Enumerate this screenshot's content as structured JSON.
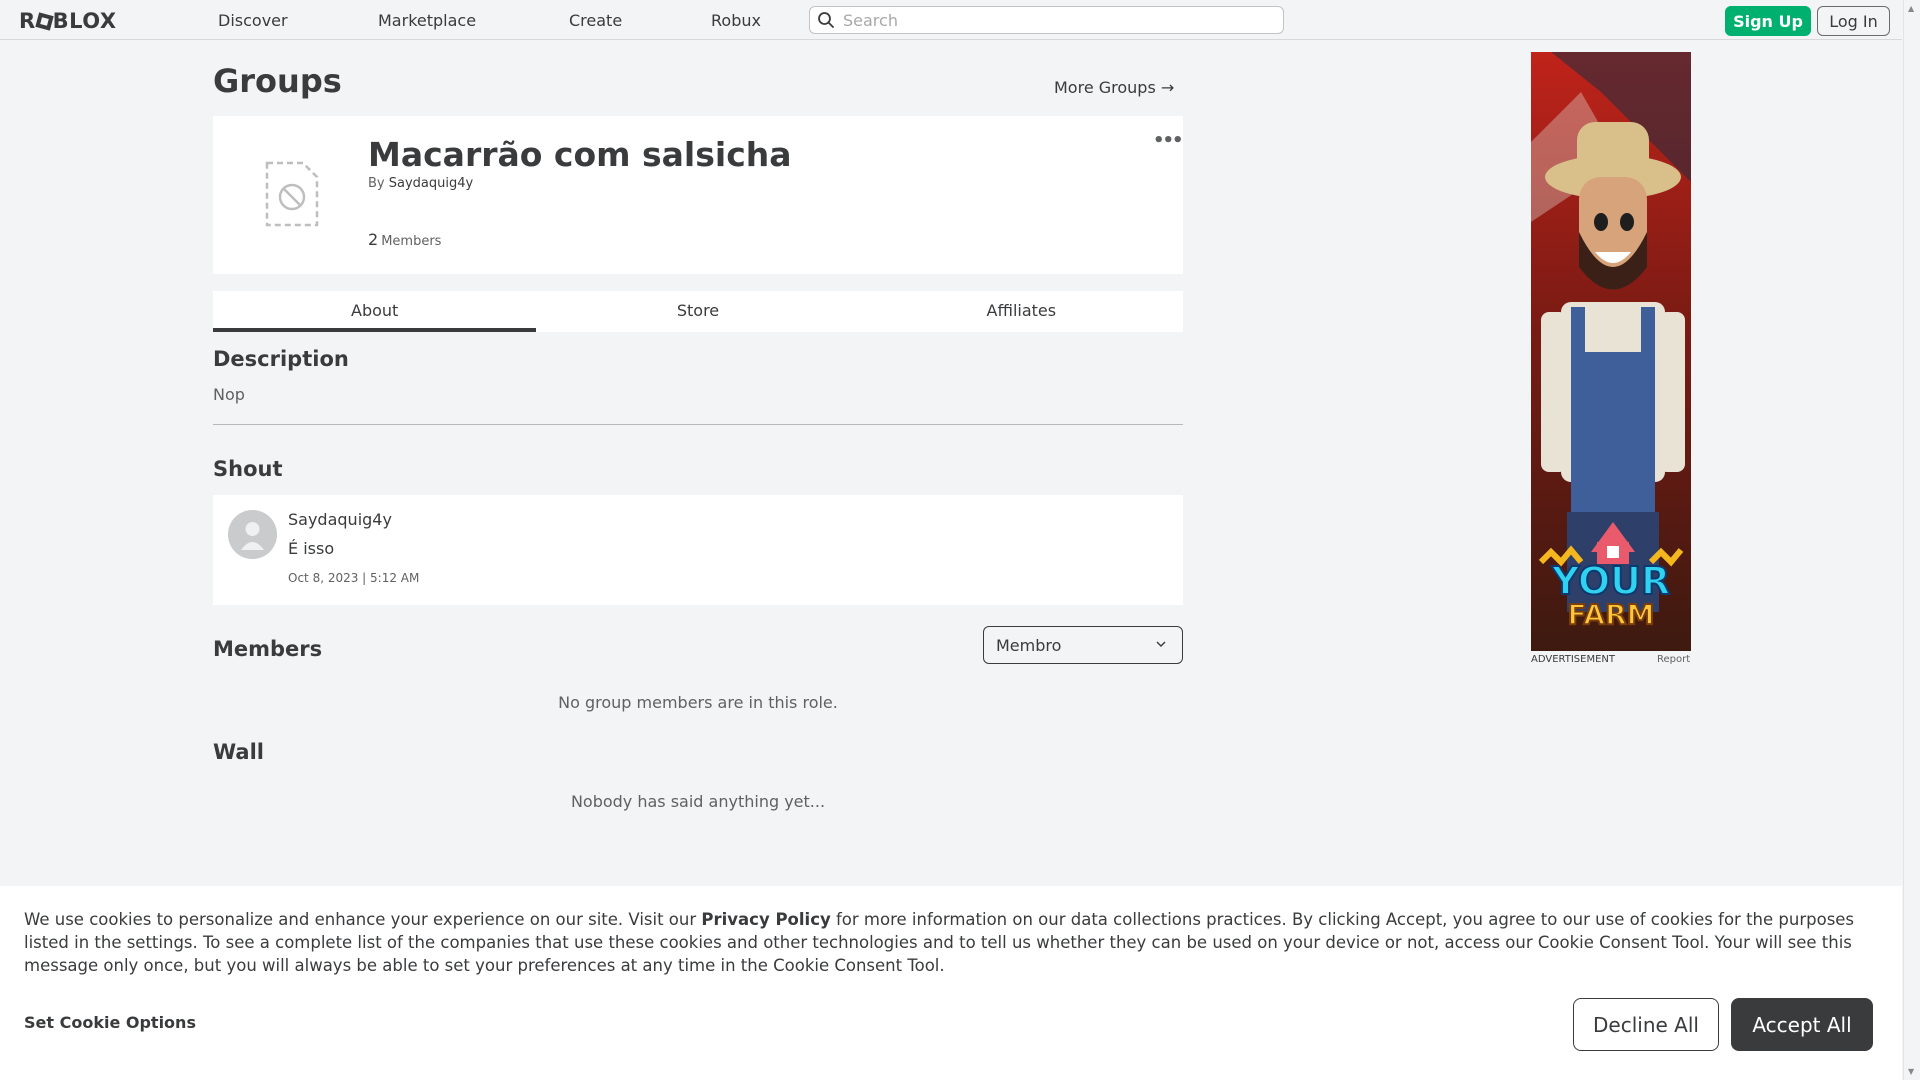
{
  "header": {
    "logo": "ROBLOX",
    "nav": [
      "Discover",
      "Marketplace",
      "Create",
      "Robux"
    ],
    "search_placeholder": "Search",
    "signup_label": "Sign Up",
    "login_label": "Log In"
  },
  "page": {
    "title": "Groups",
    "more_groups": "More Groups →"
  },
  "group": {
    "name": "Macarrão com salsicha",
    "by_label": "By",
    "owner": "Saydaquig4y",
    "member_count": "2",
    "members_label": "Members"
  },
  "tabs": [
    "About",
    "Store",
    "Affiliates"
  ],
  "description": {
    "heading": "Description",
    "text": "Nop"
  },
  "shout": {
    "heading": "Shout",
    "user": "Saydaquig4y",
    "text": "É isso",
    "date": "Oct 8, 2023 | 5:12 AM"
  },
  "members": {
    "heading": "Members",
    "role_selected": "Membro",
    "empty_message": "No group members are in this role."
  },
  "wall": {
    "heading": "Wall",
    "empty_message": "Nobody has said anything yet..."
  },
  "ad": {
    "line1": "YOUR",
    "line2": "FARM",
    "caption": "ADVERTISEMENT",
    "report": "Report"
  },
  "cookie": {
    "text_before": "We use cookies to personalize and enhance your experience on our site. Visit our ",
    "link": "Privacy Policy",
    "text_after": " for more information on our data collections practices. By clicking Accept, you agree to our use of cookies for the purposes listed in the settings. To see a complete list of the companies that use these cookies and other technologies and to tell us whether they can be used on your device or not, access our Cookie Consent Tool. Your will see this message only once, but you will always be able to set your preferences at any time in the Cookie Consent Tool.",
    "options_label": "Set Cookie Options",
    "decline_label": "Decline All",
    "accept_label": "Accept All"
  },
  "colors": {
    "accent_green": "#00b06f",
    "text_dark": "#393b3d",
    "background": "#f2f4f5"
  }
}
